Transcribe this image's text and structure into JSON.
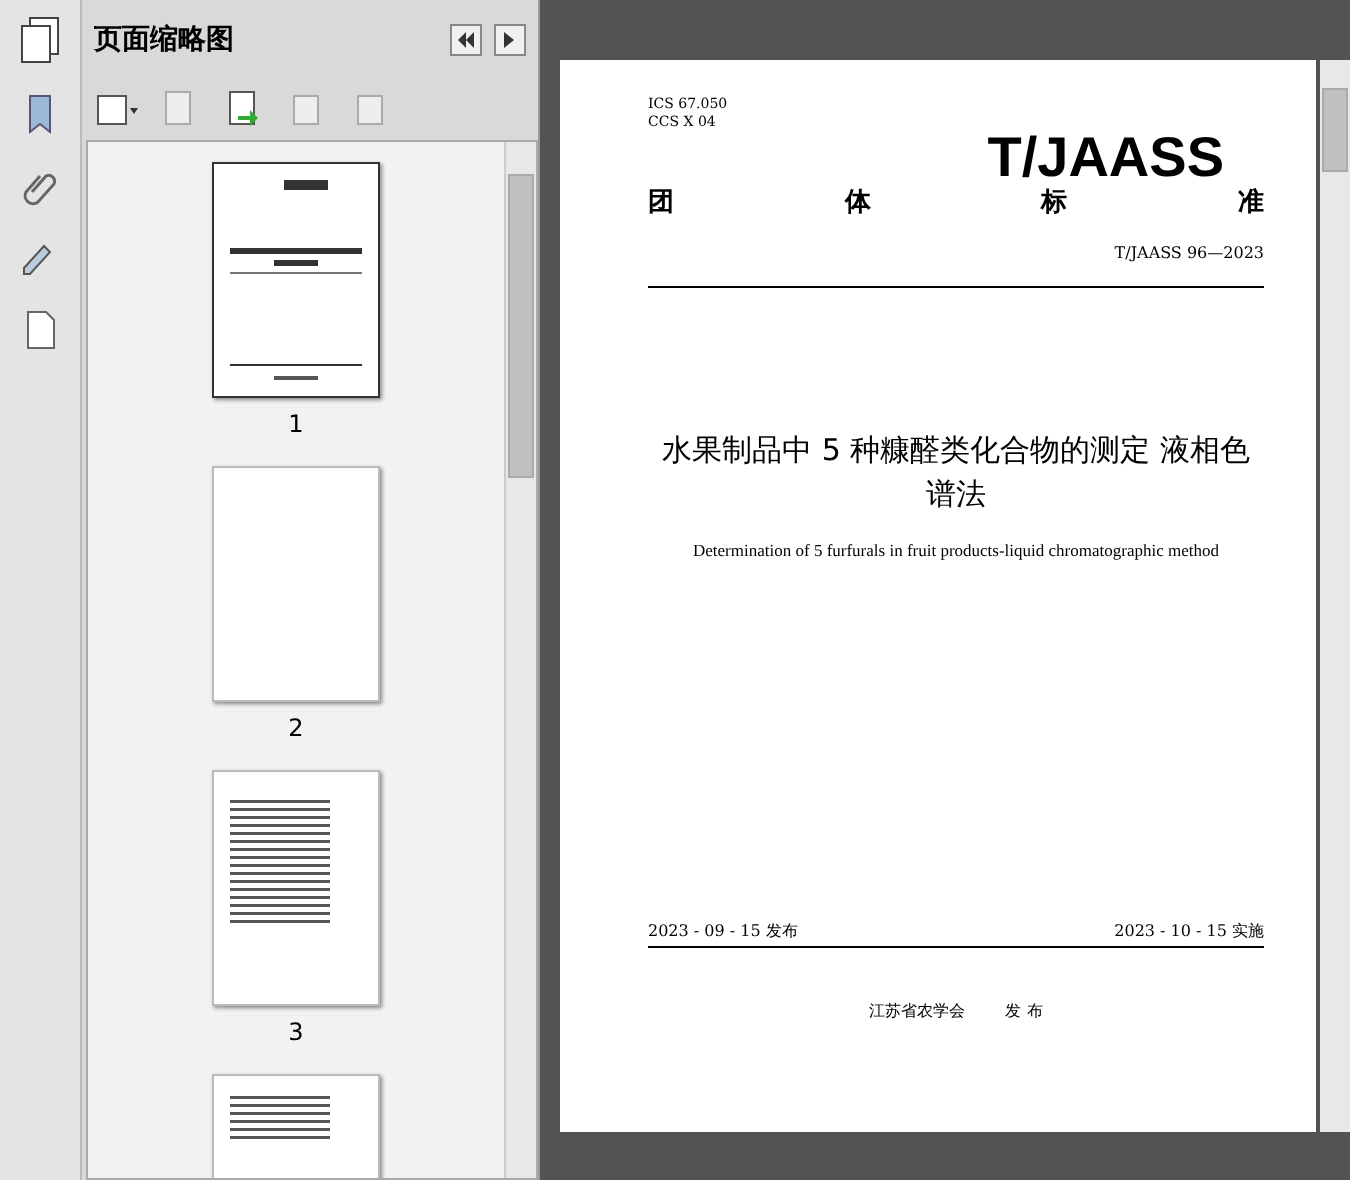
{
  "sidebar": {
    "title": "页面缩略图",
    "thumbnails": [
      {
        "page": "1",
        "kind": "cover",
        "selected": true
      },
      {
        "page": "2",
        "kind": "blank",
        "selected": false
      },
      {
        "page": "3",
        "kind": "contents",
        "selected": false
      },
      {
        "kind": "text",
        "selected": false
      }
    ]
  },
  "document": {
    "codes": [
      "ICS  67.050",
      "CCS  X 04"
    ],
    "logo": "T/JAASS",
    "group_label": [
      "团",
      "体",
      "标",
      "准"
    ],
    "standard_no": "T/JAASS 96—2023",
    "title": "水果制品中 5 种糠醛类化合物的测定 液相色谱法",
    "subtitle": "Determination of 5 furfurals in fruit products-liquid chromatographic method",
    "issue_date": "2023 - 09 - 15 发布",
    "effective_date": "2023 - 10 - 15 实施",
    "publisher": "江苏省农学会",
    "publish_label": "发  布"
  }
}
